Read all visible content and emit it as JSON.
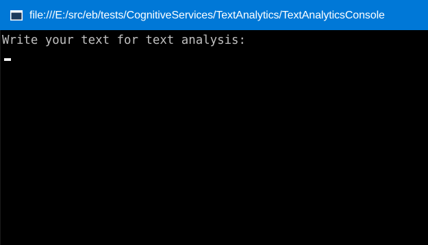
{
  "window": {
    "title": "file:///E:/src/eb/tests/CognitiveServices/TextAnalytics/TextAnalyticsConsole",
    "icon": "console-app-icon"
  },
  "console": {
    "prompt": "Write your text for text analysis:",
    "input_value": ""
  },
  "colors": {
    "titlebar": "#0078d7",
    "background": "#000000",
    "text": "#c0c0c0",
    "cursor": "#f2f2f2"
  }
}
